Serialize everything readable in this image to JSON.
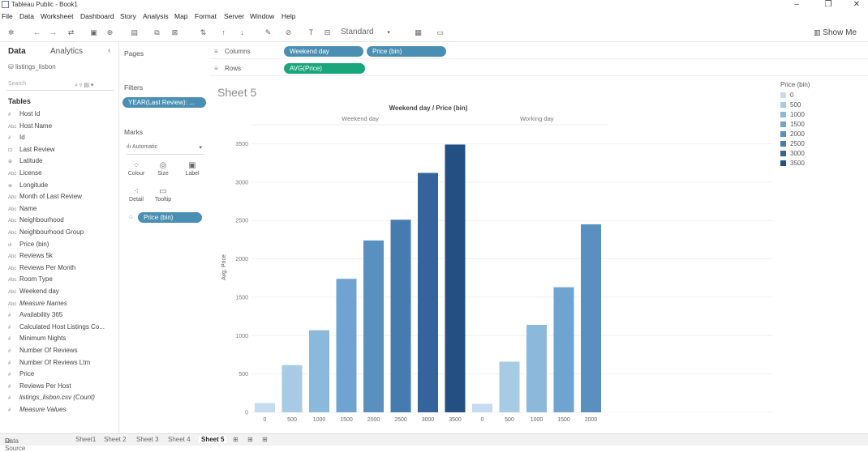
{
  "window": {
    "title": "Tableau Public - Book1"
  },
  "menu": [
    "File",
    "Data",
    "Worksheet",
    "Dashboard",
    "Story",
    "Analysis",
    "Map",
    "Format",
    "Server",
    "Window",
    "Help"
  ],
  "toolbar": {
    "fit_select": "Standard",
    "show_me": "Show Me"
  },
  "data_pane": {
    "tab_data": "Data",
    "tab_analytics": "Analytics",
    "datasource": "listings_lisbon",
    "search_placeholder": "Search",
    "tables_label": "Tables",
    "fields": [
      {
        "type": "#",
        "name": "Host Id",
        "italic": false
      },
      {
        "type": "Abc",
        "name": "Host Name",
        "italic": false
      },
      {
        "type": "#",
        "name": "Id",
        "italic": false
      },
      {
        "type": "⊡",
        "name": "Last Review",
        "italic": false
      },
      {
        "type": "⊕",
        "name": "Latitude",
        "italic": false
      },
      {
        "type": "Abc",
        "name": "License",
        "italic": false
      },
      {
        "type": "⊕",
        "name": "Longitude",
        "italic": false
      },
      {
        "type": "Abc",
        "name": "Month of Last Review",
        "italic": false
      },
      {
        "type": "Abc",
        "name": "Name",
        "italic": false
      },
      {
        "type": "Abc",
        "name": "Neighbourhood",
        "italic": false
      },
      {
        "type": "Abc",
        "name": "Neighbourhood Group",
        "italic": false
      },
      {
        "type": "ılı",
        "name": "Price (bin)",
        "italic": false
      },
      {
        "type": "Abc",
        "name": "Reviews 5k",
        "italic": false
      },
      {
        "type": "Abc",
        "name": "Reviews Per Month",
        "italic": false
      },
      {
        "type": "Abc",
        "name": "Room Type",
        "italic": false
      },
      {
        "type": "Abc",
        "name": "Weekend day",
        "italic": false
      },
      {
        "type": "Abc",
        "name": "Measure Names",
        "italic": true
      },
      {
        "type": "#",
        "name": "Availability 365",
        "italic": false
      },
      {
        "type": "#",
        "name": "Calculated Host Listings Co...",
        "italic": false
      },
      {
        "type": "#",
        "name": "Minimum Nights",
        "italic": false
      },
      {
        "type": "#",
        "name": "Number Of Reviews",
        "italic": false
      },
      {
        "type": "#",
        "name": "Number Of Reviews Ltm",
        "italic": false
      },
      {
        "type": "#",
        "name": "Price",
        "italic": false
      },
      {
        "type": "#",
        "name": "Reviews Per Host",
        "italic": false
      },
      {
        "type": "#",
        "name": "listings_lisbon.csv (Count)",
        "italic": true
      },
      {
        "type": "#",
        "name": "Measure Values",
        "italic": true
      }
    ]
  },
  "cards": {
    "pages": "Pages",
    "filters": "Filters",
    "filter_pill": "YEAR(Last Review): ...",
    "marks": "Marks",
    "marks_type": "Automatic",
    "mark_buttons": [
      "Colour",
      "Size",
      "Label",
      "Detail",
      "Tooltip"
    ],
    "marks_pill": "Price (bin)"
  },
  "shelves": {
    "columns_label": "Columns",
    "rows_label": "Rows",
    "columns_pills": [
      "Weekend day",
      "Price (bin)"
    ],
    "rows_pills": [
      "AVG(Price)"
    ]
  },
  "sheet": {
    "title": "Sheet 5"
  },
  "chart_data": {
    "type": "bar",
    "title": "Weekend day / Price (bin)",
    "ylabel": "Avg. Price",
    "ylim": [
      0,
      3600
    ],
    "yticks": [
      0,
      500,
      1000,
      1500,
      2000,
      2500,
      3000,
      3500
    ],
    "panes": [
      {
        "name": "Weekend day",
        "categories": [
          "0",
          "500",
          "1000",
          "1500",
          "2000",
          "2500",
          "3000",
          "3500"
        ],
        "values": [
          120,
          615,
          1070,
          1740,
          2240,
          2510,
          3120,
          3490
        ]
      },
      {
        "name": "Working day",
        "categories": [
          "0",
          "500",
          "1000",
          "1500",
          "2000"
        ],
        "values": [
          110,
          660,
          1140,
          1630,
          2450
        ]
      }
    ],
    "colors": {
      "0": "#c6dbef",
      "500": "#a7cbe4",
      "1000": "#8bb9dc",
      "1500": "#6fa4d0",
      "2000": "#5a90c0",
      "2500": "#467bb0",
      "3000": "#35649c",
      "3500": "#234f83"
    }
  },
  "legend": {
    "title": "Price (bin)",
    "items": [
      "0",
      "500",
      "1000",
      "1500",
      "2000",
      "2500",
      "3000",
      "3500"
    ]
  },
  "tabs": {
    "data_source": "Data Source",
    "sheets": [
      "Sheet1",
      "Sheet 2",
      "Sheet 3",
      "Sheet 4",
      "Sheet 5"
    ],
    "active": "Sheet 5"
  }
}
